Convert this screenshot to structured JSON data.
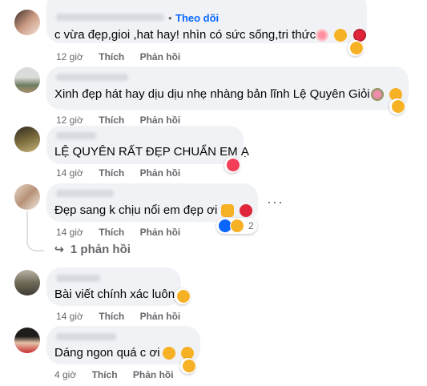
{
  "comments": [
    {
      "text": "c vừa đẹp,gioi ,hat hay! nhìn có sức sống,tri thức",
      "time": "12 giờ",
      "like": "Thích",
      "reply": "Phản hồi",
      "follow": "Theo dõi"
    },
    {
      "text": "Xinh đẹp hát hay dịu dịu nhẹ nhàng bản lĩnh Lệ Quyên Giỏi",
      "time": "12 giờ",
      "like": "Thích",
      "reply": "Phản hồi"
    },
    {
      "text": "LỆ QUYÊN RẤT ĐẸP CHUẨN EM Ạ",
      "time": "14 giờ",
      "like": "Thích",
      "reply": "Phản hồi"
    },
    {
      "text": "Đẹp sang k chịu nổi em đẹp ơi",
      "time": "14 giờ",
      "like": "Thích",
      "reply": "Phản hồi",
      "reaction_count": "2",
      "replies_link": "1 phản hồi"
    },
    {
      "text": "Bài viết chính xác luôn",
      "time": "14 giờ",
      "like": "Thích",
      "reply": "Phản hồi"
    },
    {
      "text": "Dáng ngon quá c ơi",
      "time": "4 giờ",
      "like": "Thích",
      "reply": "Phản hồi"
    }
  ],
  "more_glyph": "···",
  "colors": {
    "bubble": "#f0f2f5",
    "meta": "#65676b",
    "link": "#0866ff",
    "love": "#f33e58",
    "like": "#0866ff",
    "care": "#f7b125"
  }
}
